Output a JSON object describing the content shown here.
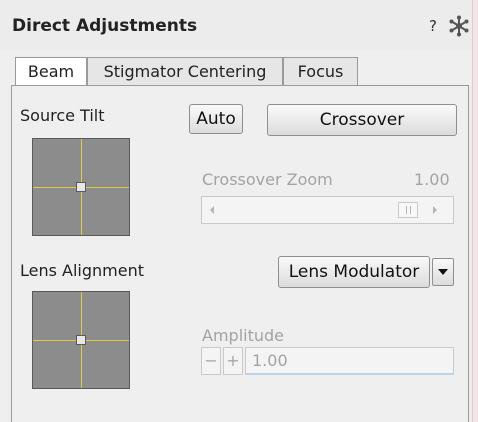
{
  "panel": {
    "title": "Direct Adjustments",
    "help_icon": "question-icon",
    "help_glyph": "?",
    "settings_icon": "molecule-settings-icon"
  },
  "tabs": [
    {
      "label": "Beam",
      "active": true
    },
    {
      "label": "Stigmator Centering",
      "active": false
    },
    {
      "label": "Focus",
      "active": false
    }
  ],
  "beam": {
    "source_tilt_label": "Source Tilt",
    "auto_label": "Auto",
    "crossover_label": "Crossover",
    "crossover_zoom_label": "Crossover Zoom",
    "crossover_zoom_value": "1.00",
    "lens_alignment_label": "Lens Alignment",
    "lens_modulator_label": "Lens Modulator",
    "amplitude_label": "Amplitude",
    "amplitude_minus": "−",
    "amplitude_plus": "+",
    "amplitude_value": "1.00"
  }
}
